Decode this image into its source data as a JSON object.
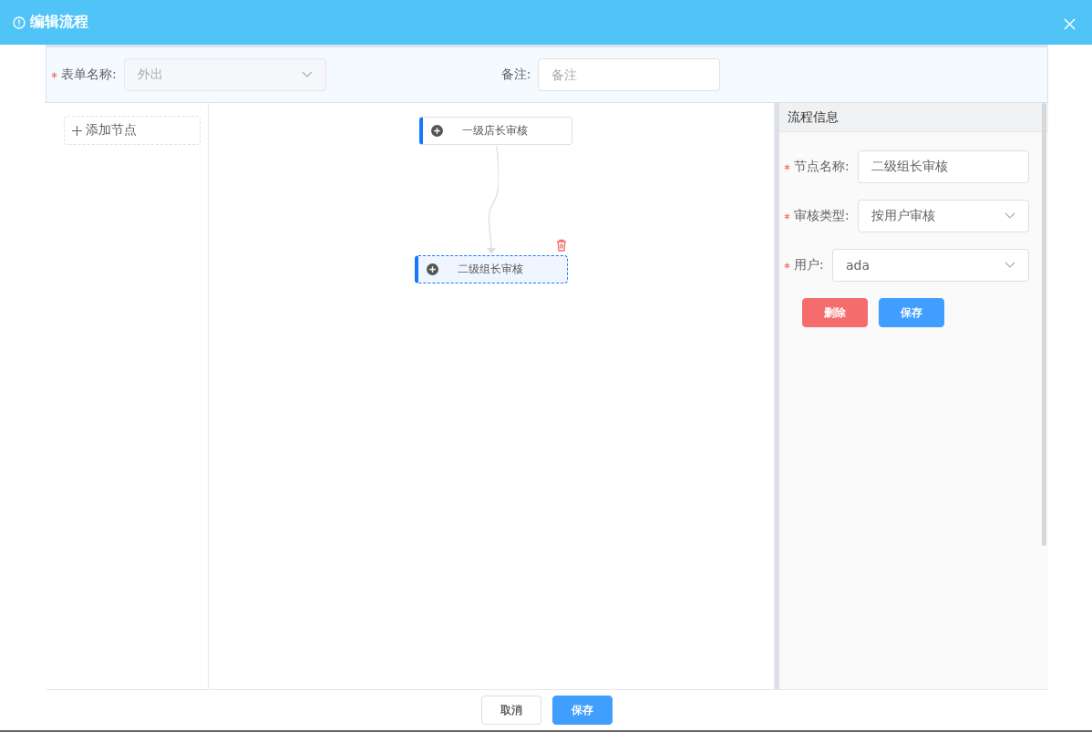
{
  "window": {
    "title": "编辑流程"
  },
  "form": {
    "form_name": {
      "label": "表单名称:",
      "required": true,
      "value": "外出",
      "disabled": true
    },
    "remark": {
      "label": "备注:",
      "placeholder": "备注"
    }
  },
  "toolbox": {
    "add_node": "添加节点"
  },
  "canvas": {
    "nodes": [
      {
        "label": "一级店长审核",
        "selected": false
      },
      {
        "label": "二级组长审核",
        "selected": true
      }
    ]
  },
  "panel": {
    "title": "流程信息",
    "fields": [
      {
        "kind": "input",
        "label": "节点名称:",
        "required": true,
        "value": "二级组长审核"
      },
      {
        "kind": "select",
        "label": "审核类型:",
        "required": true,
        "value": "按用户审核"
      },
      {
        "kind": "select",
        "label": "用户:",
        "required": true,
        "value": "ada"
      }
    ],
    "buttons": [
      {
        "kind": "danger",
        "label": "删除"
      },
      {
        "kind": "primary",
        "label": "保存"
      }
    ]
  },
  "footer": {
    "buttons": [
      {
        "kind": "default",
        "label": "取消"
      },
      {
        "kind": "primary",
        "label": "保存"
      }
    ]
  }
}
